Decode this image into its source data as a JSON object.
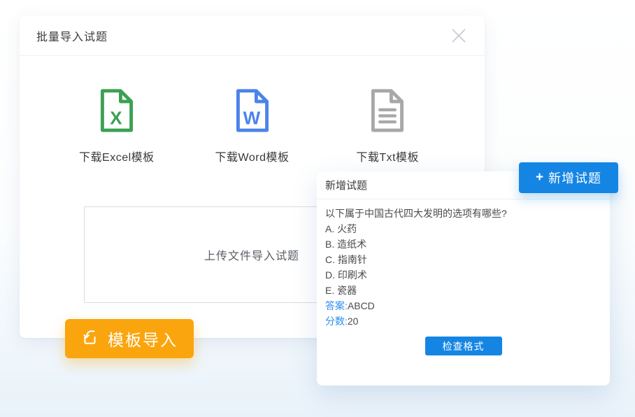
{
  "modal": {
    "title": "批量导入试题",
    "templates": [
      {
        "label": "下载Excel模板",
        "icon": "excel-file-icon",
        "color": "#3da052",
        "letter": "X"
      },
      {
        "label": "下载Word模板",
        "icon": "word-file-icon",
        "color": "#4c83ea",
        "letter": "W"
      },
      {
        "label": "下载Txt模板",
        "icon": "txt-file-icon",
        "color": "#a8a8a8",
        "letter": ""
      }
    ],
    "upload_area": {
      "text": "上传文件导入试题"
    }
  },
  "buttons": {
    "template_import": {
      "label": "模板导入",
      "color": "#faa50e"
    },
    "add_question": {
      "plus": "+",
      "label": "新增试题",
      "color": "#1585e4"
    },
    "check_format": {
      "label": "检查格式",
      "color": "#1585e4"
    }
  },
  "question_panel": {
    "title": "新增试题",
    "question": "以下属于中国古代四大发明的选项有哪些?",
    "options": [
      "A. 火药",
      "B. 造纸术",
      "C. 指南针",
      "D. 印刷术",
      "E. 瓷器"
    ],
    "answer": {
      "label": "答案:",
      "value": "ABCD"
    },
    "score": {
      "label": "分数:",
      "value": "20"
    },
    "label_color": "#2d8cf0"
  }
}
